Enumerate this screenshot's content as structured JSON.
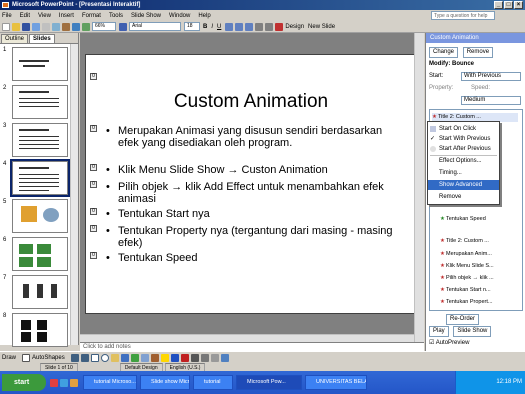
{
  "window": {
    "title": "Microsoft PowerPoint - [Presentasi Interaktif]",
    "buttons": [
      "_",
      "□",
      "×"
    ]
  },
  "menu": {
    "items": [
      "File",
      "Edit",
      "View",
      "Insert",
      "Format",
      "Tools",
      "Slide Show",
      "Window",
      "Help"
    ],
    "help_placeholder": "Type a question for help"
  },
  "toolbar": {
    "zoom": "66%",
    "font": "Arial",
    "size": "18",
    "bold": "B",
    "italic": "I",
    "underline": "U",
    "design": "Design",
    "new_slide": "New Slide"
  },
  "outline_tabs": [
    "Outline",
    "Slides"
  ],
  "thumbs": [
    "1",
    "2",
    "3",
    "4",
    "5",
    "6",
    "7",
    "8"
  ],
  "slide": {
    "title": "Custom Animation",
    "markers": [
      "0",
      "0",
      "0",
      "0",
      "0",
      "0",
      "0"
    ],
    "bullets": [
      "Merupakan Animasi yang disusun sendiri berdasarkan efek yang disediakan oleh program.",
      "Klik Menu Slide Show → Custon Animation",
      "Pilih objek → klik Add Effect untuk menambahkan efek animasi",
      "Tentukan Start nya",
      "Tentukan Property nya (tergantung dari masing - masing efek)",
      "Tentukan Speed"
    ]
  },
  "notes_placeholder": "Click to add notes",
  "draw": {
    "draw": "Draw",
    "autoshapes": "AutoShapes"
  },
  "status": {
    "slide": "Slide 1 of 10",
    "design": "Default Design",
    "lang": "English (U.S.)"
  },
  "taskpane": {
    "title": "Custom Animation",
    "change": "Change",
    "remove": "Remove",
    "modify": "Modify: Bounce",
    "start_label": "Start:",
    "start_value": "With Previous",
    "property_label": "Property:",
    "speed_label": "Speed:",
    "speed_value": "Medium",
    "list_items": [
      "Title 2: Custom ...",
      "Tentukan Speed",
      "Title 2: Custom ...",
      "Merupakan Anim...",
      "Klik Menu Slide S...",
      "Pilih objek → klik ...",
      "Tentukan Start n...",
      "Tentukan Propert...",
      "Tentukan Speed"
    ],
    "reorder": "Re-Order",
    "play": "Play",
    "slideshow": "Slide Show",
    "autopreview": "AutoPreview"
  },
  "context_menu": {
    "items": [
      "Start On Click",
      "Start With Previous",
      "Start After Previous",
      "Effect Options...",
      "Timing...",
      "Show Advanced Timeline",
      "Remove"
    ],
    "highlighted": 5,
    "checked": 1
  },
  "taskbar": {
    "start": "start",
    "buttons": [
      "tutorial Microso...",
      "Slide show Micr...",
      "tutorial",
      "Microsoft Pow...",
      "UNIVERSITAS BELAJ..."
    ],
    "active": 3,
    "clock": "12:18 PM"
  },
  "colors": {
    "title_bar": "#0a246a",
    "highlight": "#316ac5",
    "taskbar": "#2456c8",
    "start": "#3c9a3c"
  }
}
